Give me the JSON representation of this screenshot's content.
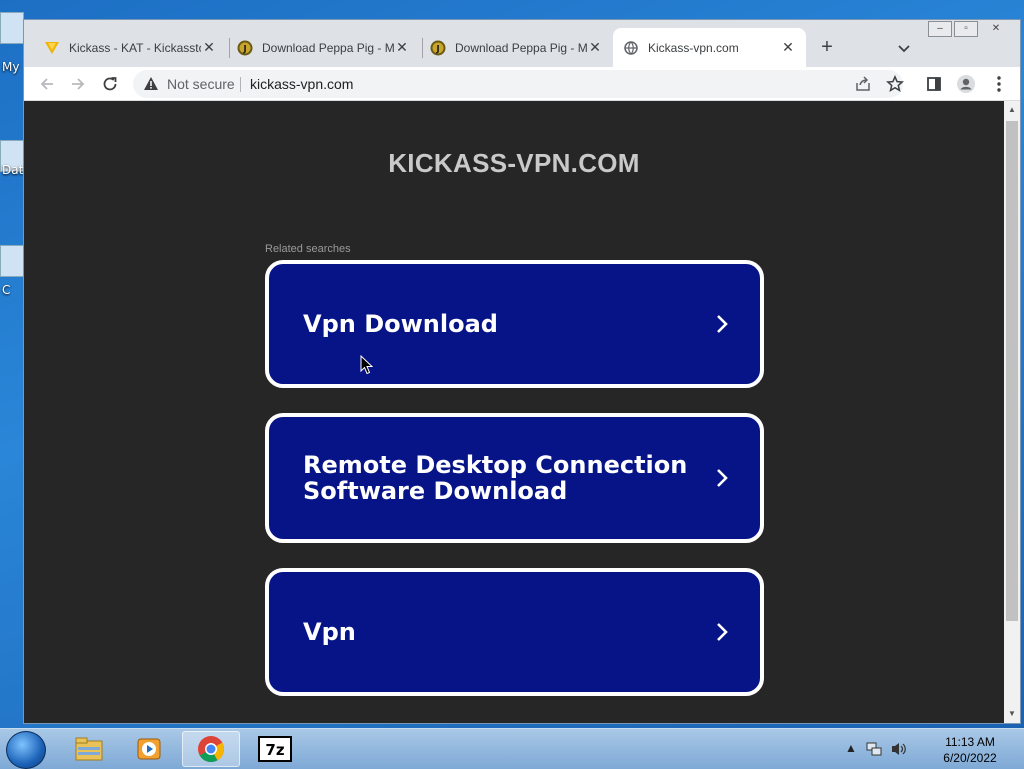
{
  "desktop": {
    "labels": [
      "My",
      "Dat",
      "C"
    ]
  },
  "browser": {
    "tabs": [
      {
        "title": "Kickass - KAT - Kickasstorr",
        "icon": "kat-favicon-icon",
        "active": false
      },
      {
        "title": "Download Peppa Pig - Movie",
        "icon": "torrent-favicon-icon",
        "active": false
      },
      {
        "title": "Download Peppa Pig - Movie",
        "icon": "torrent-favicon-icon",
        "active": false
      },
      {
        "title": "Kickass-vpn.com",
        "icon": "globe-icon",
        "active": true
      }
    ],
    "address_bar": {
      "security_label": "Not secure",
      "url": "kickass-vpn.com"
    }
  },
  "page": {
    "site_title": "KICKASS-VPN.COM",
    "related_label": "Related searches",
    "search_buttons": [
      {
        "label": "Vpn Download"
      },
      {
        "label": "Remote Desktop Connection Software Download"
      },
      {
        "label": "Vpn"
      }
    ]
  },
  "taskbar": {
    "apps": [
      "file-explorer-icon",
      "media-player-icon",
      "chrome-icon",
      "7zip-icon"
    ],
    "active_app": "chrome-icon",
    "clock": {
      "time": "11:13 AM",
      "date": "6/20/2022"
    }
  },
  "colors": {
    "page_bg": "#262626",
    "button_bg": "#071487",
    "title_color": "#c9c9c9"
  }
}
